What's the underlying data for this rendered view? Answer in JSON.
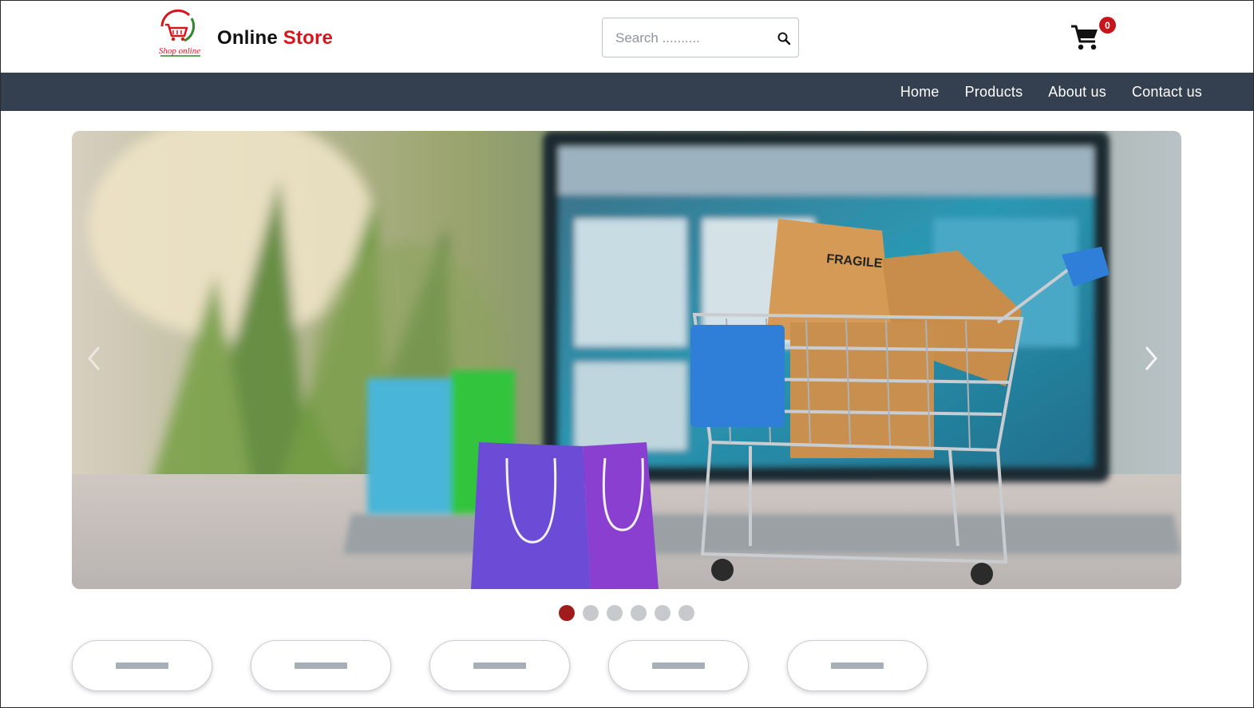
{
  "header": {
    "logo_caption": "Shop online",
    "brand_part1": "Online",
    "brand_part2": "Store",
    "brand_accent_color": "#d7161b",
    "search_placeholder": "Search ..........",
    "search_icon": "search-icon",
    "cart_icon": "shopping-cart-icon",
    "cart_count": "0"
  },
  "nav": {
    "background_color": "#343f4f",
    "items": [
      "Home",
      "Products",
      "About us",
      "Contact us"
    ]
  },
  "carousel": {
    "image_description_icon": "shopping-cart-boxes-laptop-banner",
    "prev_icon": "chevron-left-icon",
    "next_icon": "chevron-right-icon",
    "slide_count": 6,
    "active_index": 0,
    "active_dot_color": "#a01c1c"
  },
  "categories": {
    "count": 5
  }
}
